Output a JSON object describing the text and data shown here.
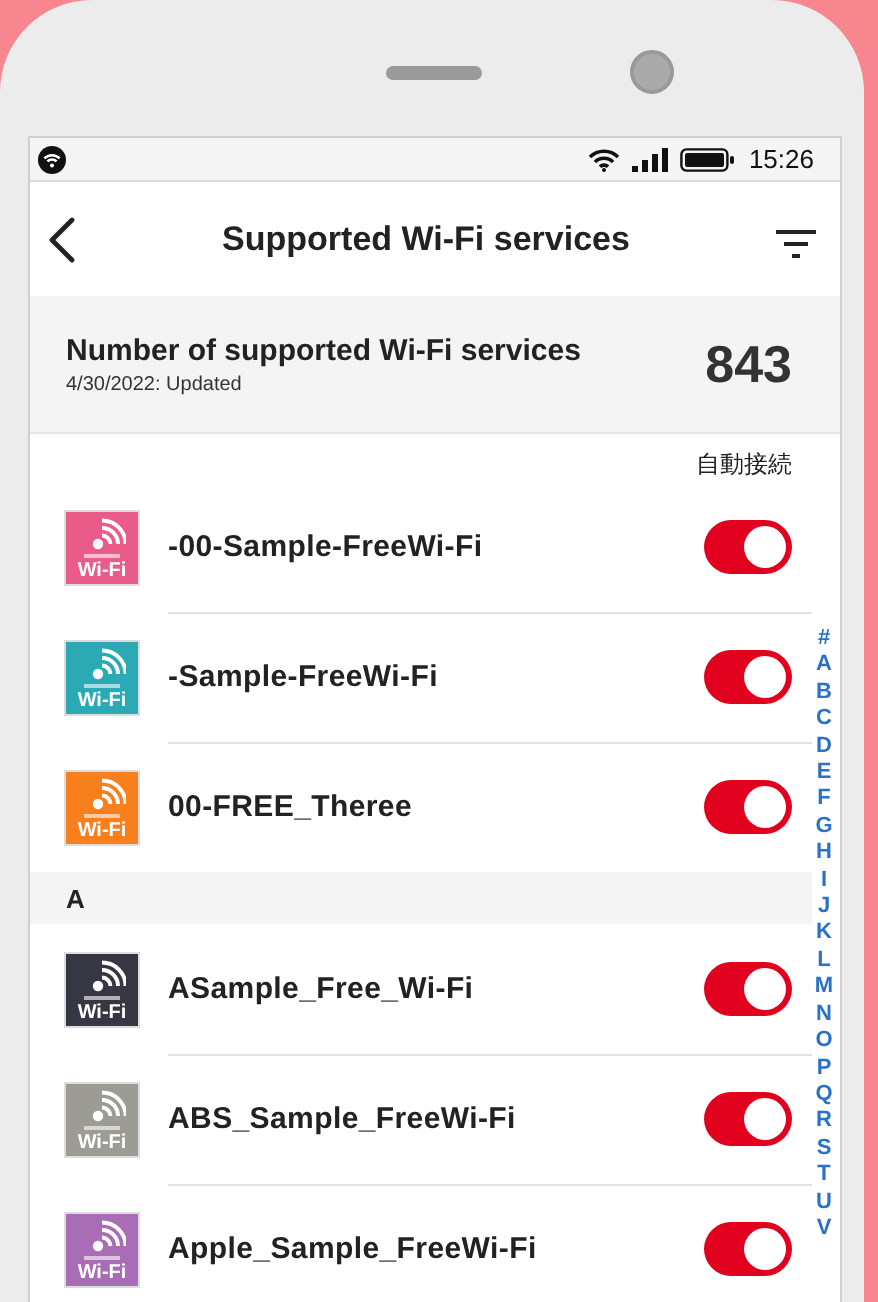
{
  "status_bar": {
    "time": "15:26"
  },
  "nav": {
    "title": "Supported Wi-Fi services"
  },
  "summary": {
    "label": "Number of supported Wi-Fi services",
    "updated": "4/30/2022: Updated",
    "count": "843"
  },
  "column_header": "自動接続",
  "sections": [
    {
      "items": [
        {
          "name": "-00-Sample-FreeWi-Fi",
          "color": "#e95c8a",
          "logo_label": "Wi-Fi",
          "auto_connect": true
        },
        {
          "name": "-Sample-FreeWi-Fi",
          "color": "#2ba9b4",
          "logo_label": "Wi-Fi",
          "auto_connect": true
        },
        {
          "name": "00-FREE_Theree",
          "color": "#f77f1e",
          "logo_label": "Wi-Fi",
          "auto_connect": true
        }
      ]
    },
    {
      "header": "A",
      "items": [
        {
          "name": "ASample_Free_Wi-Fi",
          "color": "#373744",
          "logo_label": "Wi-Fi",
          "auto_connect": true
        },
        {
          "name": "ABS_Sample_FreeWi-Fi",
          "color": "#9c9c94",
          "logo_label": "Wi-Fi",
          "auto_connect": true
        },
        {
          "name": "Apple_Sample_FreeWi-Fi",
          "color": "#a86db4",
          "logo_label": "Wi-Fi",
          "auto_connect": true
        }
      ]
    }
  ],
  "index": [
    "#",
    "A",
    "B",
    "C",
    "D",
    "E",
    "F",
    "G",
    "H",
    "I",
    "J",
    "K",
    "L",
    "M",
    "N",
    "O",
    "P",
    "Q",
    "R",
    "S",
    "T",
    "U",
    "V"
  ]
}
